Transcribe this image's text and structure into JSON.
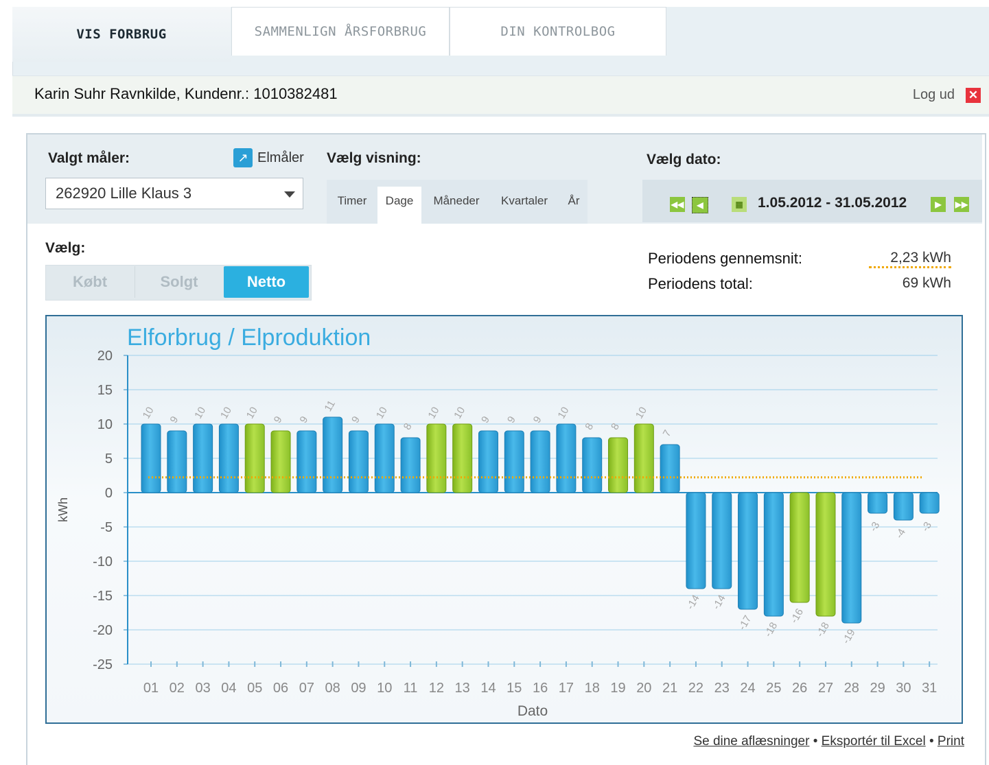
{
  "tabs": [
    {
      "label": "VIS FORBRUG",
      "active": true
    },
    {
      "label": "SAMMENLIGN ÅRSFORBRUG",
      "active": false
    },
    {
      "label": "DIN KONTROLBOG",
      "active": false
    }
  ],
  "customer": {
    "name": "Karin Suhr Ravnkilde",
    "separator": ",",
    "number_label": "Kundenr.:",
    "number": "1010382481",
    "logout_label": "Log ud"
  },
  "meter": {
    "label": "Valgt måler:",
    "checkbox_label": "Elmåler",
    "selected": "262920 Lille Klaus 3"
  },
  "view": {
    "label": "Vælg visning:",
    "options": [
      "Timer",
      "Dage",
      "Måneder",
      "Kvartaler",
      "År"
    ],
    "selected": "Dage"
  },
  "date": {
    "label": "Vælg dato:",
    "range": "1.05.2012 - 31.05.2012"
  },
  "choose": {
    "label": "Vælg:",
    "options": [
      "Købt",
      "Solgt",
      "Netto"
    ],
    "selected": "Netto"
  },
  "stats": {
    "average_label": "Periodens gennemsnit:",
    "average_value": "2,23 kWh",
    "total_label": "Periodens total:",
    "total_value": "69 kWh"
  },
  "colors": {
    "blue_bar": "#35a9df",
    "green_bar": "#9ccf2a",
    "average_line": "#f0a800",
    "accent": "#2bb0e0"
  },
  "chart_data": {
    "type": "bar",
    "title": "Elforbrug / Elproduktion",
    "xlabel": "Dato",
    "ylabel": "kWh",
    "ylim": [
      -25,
      20
    ],
    "yticks": [
      20,
      15,
      10,
      5,
      0,
      -5,
      -10,
      -15,
      -20,
      -25
    ],
    "categories": [
      "01",
      "02",
      "03",
      "04",
      "05",
      "06",
      "07",
      "08",
      "09",
      "10",
      "11",
      "12",
      "13",
      "14",
      "15",
      "16",
      "17",
      "18",
      "19",
      "20",
      "21",
      "22",
      "23",
      "24",
      "25",
      "26",
      "27",
      "28",
      "29",
      "30",
      "31"
    ],
    "values": [
      10,
      9,
      10,
      10,
      10,
      9,
      9,
      11,
      9,
      10,
      8,
      10,
      10,
      9,
      9,
      9,
      10,
      8,
      8,
      10,
      7,
      -14,
      -14,
      -17,
      -18,
      -16,
      -18,
      -19,
      -3,
      -4,
      -3
    ],
    "bar_colors": [
      "blue",
      "blue",
      "blue",
      "blue",
      "green",
      "green",
      "blue",
      "blue",
      "blue",
      "blue",
      "blue",
      "green",
      "green",
      "blue",
      "blue",
      "blue",
      "blue",
      "blue",
      "green",
      "green",
      "blue",
      "blue",
      "blue",
      "blue",
      "blue",
      "green",
      "green",
      "blue",
      "blue",
      "blue",
      "blue"
    ],
    "average": 2.23
  },
  "footer": {
    "links": [
      "Se dine aflæsninger",
      "Eksportér til Excel",
      "Print"
    ],
    "separator": "•"
  }
}
